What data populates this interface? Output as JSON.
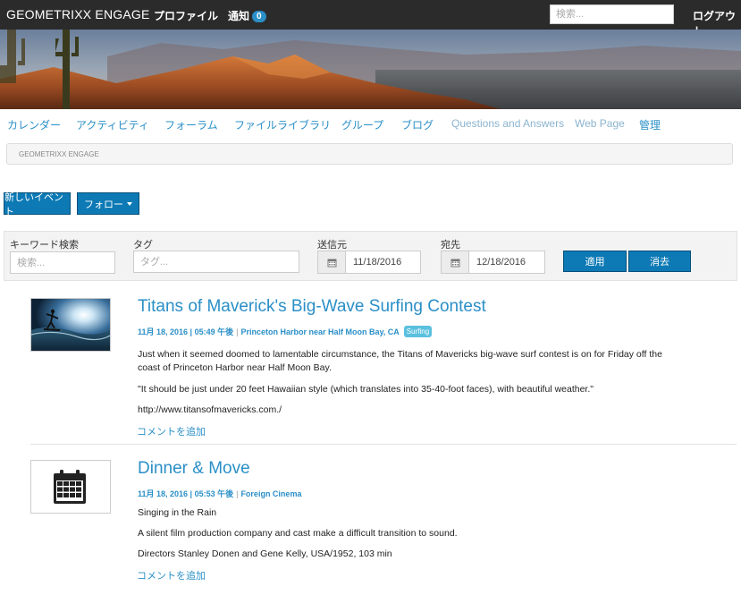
{
  "header": {
    "brand": "GEOMETRIXX ENGAGE",
    "profile_label": "プロファイル",
    "notifications_label": "通知",
    "notifications_count": "0",
    "search_placeholder": "検索...",
    "logout_label": "ログアウト"
  },
  "nav": {
    "items": [
      {
        "label": "カレンダー"
      },
      {
        "label": "アクティビティ"
      },
      {
        "label": "フォーラム"
      },
      {
        "label": "ファイルライブラリ"
      },
      {
        "label": "グループ"
      },
      {
        "label": "ブログ"
      },
      {
        "label": "Questions and Answers"
      },
      {
        "label": "Web Page"
      },
      {
        "label": "管理"
      }
    ]
  },
  "breadcrumb": {
    "label": "GEOMETRIXX ENGAGE"
  },
  "actions": {
    "new_event_label": "新しいイベント",
    "follow_label": "フォロー"
  },
  "filter": {
    "keyword_label": "キーワード検索",
    "keyword_placeholder": "検索...",
    "tag_label": "タグ",
    "tag_placeholder": "タグ...",
    "from_label": "送信元",
    "from_value": "11/18/2016",
    "to_label": "宛先",
    "to_value": "12/18/2016",
    "apply_label": "適用",
    "clear_label": "消去"
  },
  "events": [
    {
      "title": "Titans of Maverick's Big-Wave Surfing Contest",
      "datetime": "11月 18, 2016 | 05:49 午後",
      "location": "Princeton Harbor near Half Moon Bay, CA",
      "tag": "Surfing",
      "paragraphs": [
        "Just when it seemed doomed to lamentable circumstance, the Titans of Mavericks big-wave surf contest is on for Friday off the coast of Princeton Harbor near Half Moon Bay.",
        "\"It should be just under 20 feet Hawaiian style (which translates into 35-40-foot faces), with beautiful weather.\"",
        "http://www.titansofmavericks.com./"
      ],
      "comment_label": "コメントを追加"
    },
    {
      "title": "Dinner & Move",
      "datetime": "11月 18, 2016 | 05:53 午後",
      "location": "Foreign Cinema",
      "paragraphs": [
        "Singing in the Rain",
        "A silent film production company and cast make a difficult transition to sound.",
        "Directors Stanley Donen and Gene Kelly, USA/1952, 103 min"
      ],
      "comment_label": "コメントを追加"
    }
  ],
  "colors": {
    "topbar": "#2b2b2b",
    "link": "#2a8fc7",
    "button": "#0d7ab5"
  }
}
